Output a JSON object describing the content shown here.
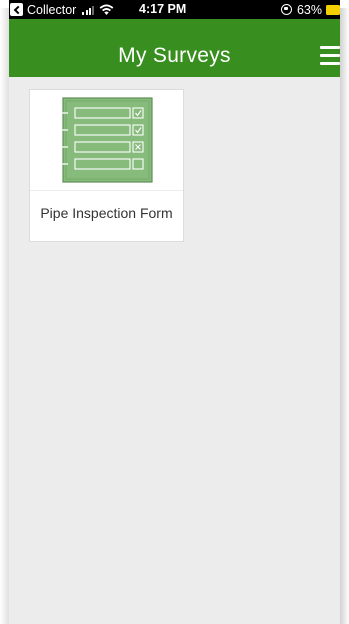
{
  "status_bar": {
    "back_app": "Collector",
    "time": "4:17 PM",
    "battery_percent": "63%",
    "battery_color": "#f5d000"
  },
  "header": {
    "title": "My Surveys",
    "color": "#388e1f",
    "menu_icon": "hamburger-menu-icon"
  },
  "surveys": [
    {
      "title": "Pipe Inspection Form",
      "icon": "form-checklist-icon"
    }
  ]
}
